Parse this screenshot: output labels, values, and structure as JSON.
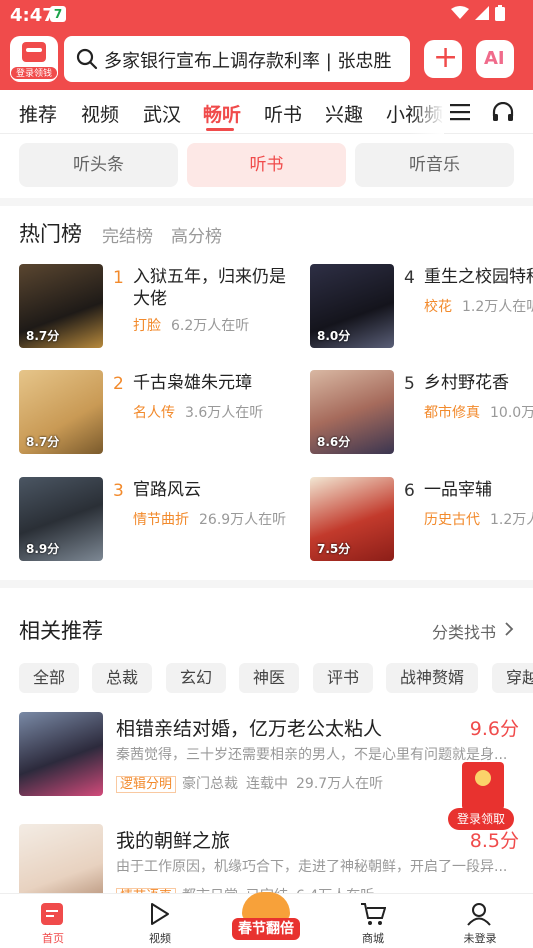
{
  "status": {
    "time": "4:47",
    "badge": "7"
  },
  "header": {
    "logo_tag": "登录领钱",
    "search_text": "多家银行宣布上调存款利率 | 张忠胜",
    "ai_label": "AI"
  },
  "catnav": {
    "tabs": [
      "推荐",
      "视频",
      "武汉",
      "畅听",
      "听书",
      "兴趣",
      "小视频"
    ],
    "active": "畅听"
  },
  "segments": [
    "听头条",
    "听书",
    "听音乐"
  ],
  "hot": {
    "title": "热门榜",
    "subtabs": [
      "完结榜",
      "高分榜"
    ],
    "items": [
      {
        "rank": "1",
        "title": "入狱五年，归来仍是大佬",
        "tag": "打脸",
        "listeners": "6.2万人在听",
        "score": "8.7分"
      },
      {
        "rank": "2",
        "title": "千古枭雄朱元璋",
        "tag": "名人传",
        "listeners": "3.6万人在听",
        "score": "8.7分"
      },
      {
        "rank": "3",
        "title": "官路风云",
        "tag": "情节曲折",
        "listeners": "26.9万人在听",
        "score": "8.9分"
      },
      {
        "rank": "4",
        "title": "重生之校园特种",
        "tag": "校花",
        "listeners": "1.2万人在听",
        "score": "8.0分"
      },
      {
        "rank": "5",
        "title": "乡村野花香",
        "tag": "都市修真",
        "listeners": "10.0万",
        "score": "8.6分"
      },
      {
        "rank": "6",
        "title": "一品宰辅",
        "tag": "历史古代",
        "listeners": "1.2万人",
        "score": "7.5分"
      }
    ]
  },
  "recommend": {
    "title": "相关推荐",
    "more": "分类找书",
    "chips": [
      "全部",
      "总裁",
      "玄幻",
      "神医",
      "评书",
      "战神赘婿",
      "穿越"
    ],
    "items": [
      {
        "title": "相错亲结对婚，亿万老公太粘人",
        "score": "9.6分",
        "desc": "秦茜觉得，三十岁还需要相亲的男人，不是心里有问题就是身...",
        "tag": "逻辑分明",
        "genre": "豪门总裁",
        "status": "连载中",
        "listeners": "29.7万人在听"
      },
      {
        "title": "我的朝鲜之旅",
        "score": "8.5分",
        "desc": "由于工作原因，机缘巧合下，走进了神秘朝鲜，开启了一段异...",
        "tag": "情节语真",
        "genre": "都市日常",
        "status": "已完结",
        "listeners": "6.4万人在听"
      }
    ]
  },
  "envelope": {
    "label": "登录领取"
  },
  "bottomnav": {
    "items": [
      "首页",
      "视频",
      "春节翻倍",
      "商城",
      "未登录"
    ]
  },
  "colors": {
    "brand": "#f04b4b",
    "accent_orange": "#f28a2c"
  }
}
